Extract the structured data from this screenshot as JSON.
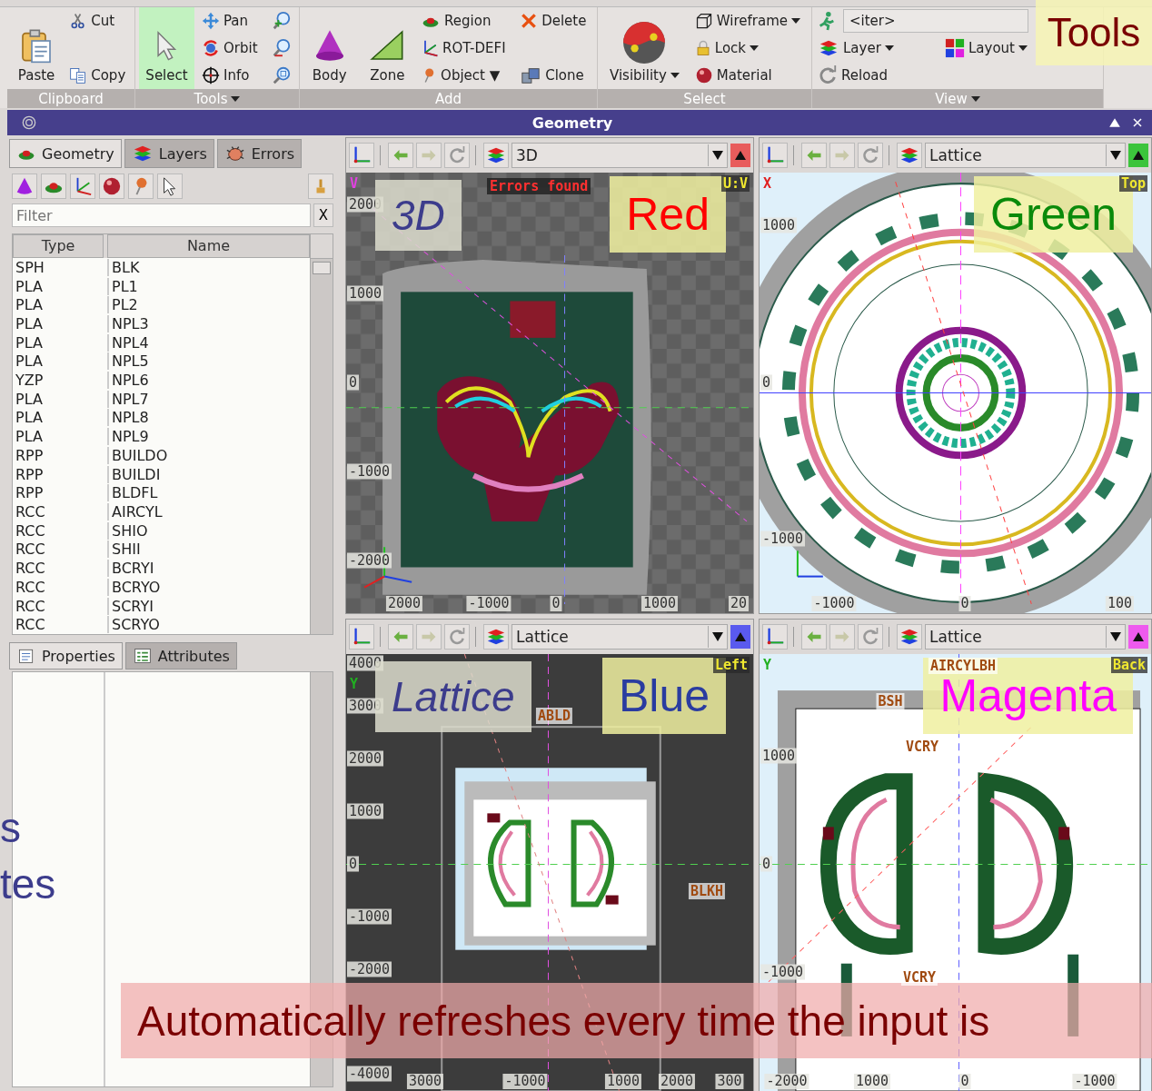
{
  "ribbon": {
    "groups": [
      {
        "label": "Clipboard",
        "menu": false,
        "buttons": [
          {
            "kind": "large",
            "label": "Paste"
          },
          {
            "kind": "small",
            "label": "Cut"
          },
          {
            "kind": "small",
            "label": "Copy"
          }
        ]
      },
      {
        "label": "Tools",
        "menu": true,
        "buttons": [
          {
            "kind": "large",
            "label": "Select",
            "selected": true
          },
          {
            "kind": "small",
            "label": "Pan",
            "selected": false
          },
          {
            "kind": "small",
            "label": "Orbit",
            "selected": false
          },
          {
            "kind": "small",
            "label": "Info",
            "selected": false
          },
          {
            "kind": "icon"
          },
          {
            "kind": "icon"
          },
          {
            "kind": "icon"
          }
        ]
      },
      {
        "label": "Add",
        "menu": false,
        "buttons": [
          {
            "kind": "large",
            "label": "Body"
          },
          {
            "kind": "large",
            "label": "Zone"
          },
          {
            "kind": "small",
            "label": "Region"
          },
          {
            "kind": "small",
            "label": "ROT-DEFI"
          },
          {
            "kind": "small",
            "label": "Object ▼"
          },
          {
            "kind": "small",
            "label": "Delete"
          },
          {
            "kind": "small",
            "label": "Clone"
          }
        ]
      },
      {
        "label": "Select",
        "menu": false,
        "buttons": [
          {
            "kind": "large",
            "label": "Visibility",
            "menu": true
          },
          {
            "kind": "small",
            "label": "Wireframe",
            "menu": true
          },
          {
            "kind": "small",
            "label": "Lock",
            "menu": true
          },
          {
            "kind": "small",
            "label": "Material",
            "menu": false
          }
        ]
      },
      {
        "label": "View",
        "menu": true,
        "buttons": [
          {
            "kind": "icon"
          },
          {
            "kind": "combo",
            "value": "<iter>"
          },
          {
            "kind": "small",
            "label": "Layer",
            "menu": true
          },
          {
            "kind": "small",
            "label": "Layout",
            "menu": true
          },
          {
            "kind": "small",
            "label": "Reload",
            "menu": false
          }
        ]
      }
    ]
  },
  "title": "Geometry",
  "panel": {
    "tabs": [
      {
        "label": "Geometry",
        "selected": true
      },
      {
        "label": "Layers",
        "selected": false
      },
      {
        "label": "Errors",
        "selected": false
      }
    ],
    "filter": {
      "placeholder": "Filter",
      "clear": "X"
    },
    "columns": [
      "Type",
      "Name"
    ],
    "rows": [
      [
        "SPH",
        "BLK"
      ],
      [
        "PLA",
        "PL1"
      ],
      [
        "PLA",
        "PL2"
      ],
      [
        "PLA",
        "NPL3"
      ],
      [
        "PLA",
        "NPL4"
      ],
      [
        "PLA",
        "NPL5"
      ],
      [
        "YZP",
        "NPL6"
      ],
      [
        "PLA",
        "NPL7"
      ],
      [
        "PLA",
        "NPL8"
      ],
      [
        "PLA",
        "NPL9"
      ],
      [
        "RPP",
        "BUILDO"
      ],
      [
        "RPP",
        "BUILDI"
      ],
      [
        "RPP",
        "BLDFL"
      ],
      [
        "RCC",
        "AIRCYL"
      ],
      [
        "RCC",
        "SHIO"
      ],
      [
        "RCC",
        "SHII"
      ],
      [
        "RCC",
        "BCRYI"
      ],
      [
        "RCC",
        "BCRYO"
      ],
      [
        "RCC",
        "SCRYI"
      ],
      [
        "RCC",
        "SCRYO"
      ]
    ],
    "bottom_tabs": [
      {
        "label": "Properties",
        "selected": true
      },
      {
        "label": "Attributes",
        "selected": false
      }
    ]
  },
  "views": [
    {
      "kind": "perspective",
      "layer": "3D",
      "color": "#e85c5c",
      "caption": "3D",
      "tag": {
        "text": "Red",
        "color": "#ff0000"
      },
      "corner_left": "V",
      "corner_right": "U:V",
      "status": "Errors found",
      "y_ticks": [
        "2000",
        "1000",
        "0",
        "-1000",
        "-2000"
      ],
      "x_ticks": [
        "2000",
        "-1000",
        "0",
        "1000",
        "20"
      ]
    },
    {
      "kind": "top",
      "layer": "Lattice",
      "color": "#3cc43c",
      "tag": {
        "text": "Green",
        "color": "#0a8a0a"
      },
      "corner_left": "X",
      "corner_right": "Top",
      "y_ticks": [
        "1000",
        "0",
        "-1000"
      ],
      "x_ticks": [
        "-1000",
        "0",
        "100"
      ]
    },
    {
      "kind": "left",
      "layer": "Lattice",
      "color": "#5a5aee",
      "caption": "Lattice",
      "tag": {
        "text": "Blue",
        "color": "#2a3ca0"
      },
      "corner_left": "Y",
      "corner_right": "Left",
      "region_labels": [
        "ABLD",
        "BLKH"
      ],
      "y_ticks": [
        "4000",
        "3000",
        "2000",
        "1000",
        "0",
        "-1000",
        "-2000",
        "-4000"
      ],
      "x_ticks": [
        "3000",
        "-1000",
        "1000",
        "2000",
        "300"
      ]
    },
    {
      "kind": "back",
      "layer": "Lattice",
      "color": "#ee5aee",
      "tag": {
        "text": "Magenta",
        "color": "#ff00ff"
      },
      "corner_left": "Y",
      "corner_right": "Back",
      "region_labels": [
        "AIRCYLBH",
        "BSH",
        "VCRY",
        "VCRY"
      ],
      "y_ticks": [
        "1000",
        "0",
        "-1000"
      ],
      "x_ticks": [
        "-2000",
        "1000",
        "0",
        "-1000"
      ]
    }
  ],
  "overlays": {
    "corner": "Tools",
    "side": [
      "s",
      "tes"
    ],
    "banner": "Automatically refreshes every time the input is"
  }
}
